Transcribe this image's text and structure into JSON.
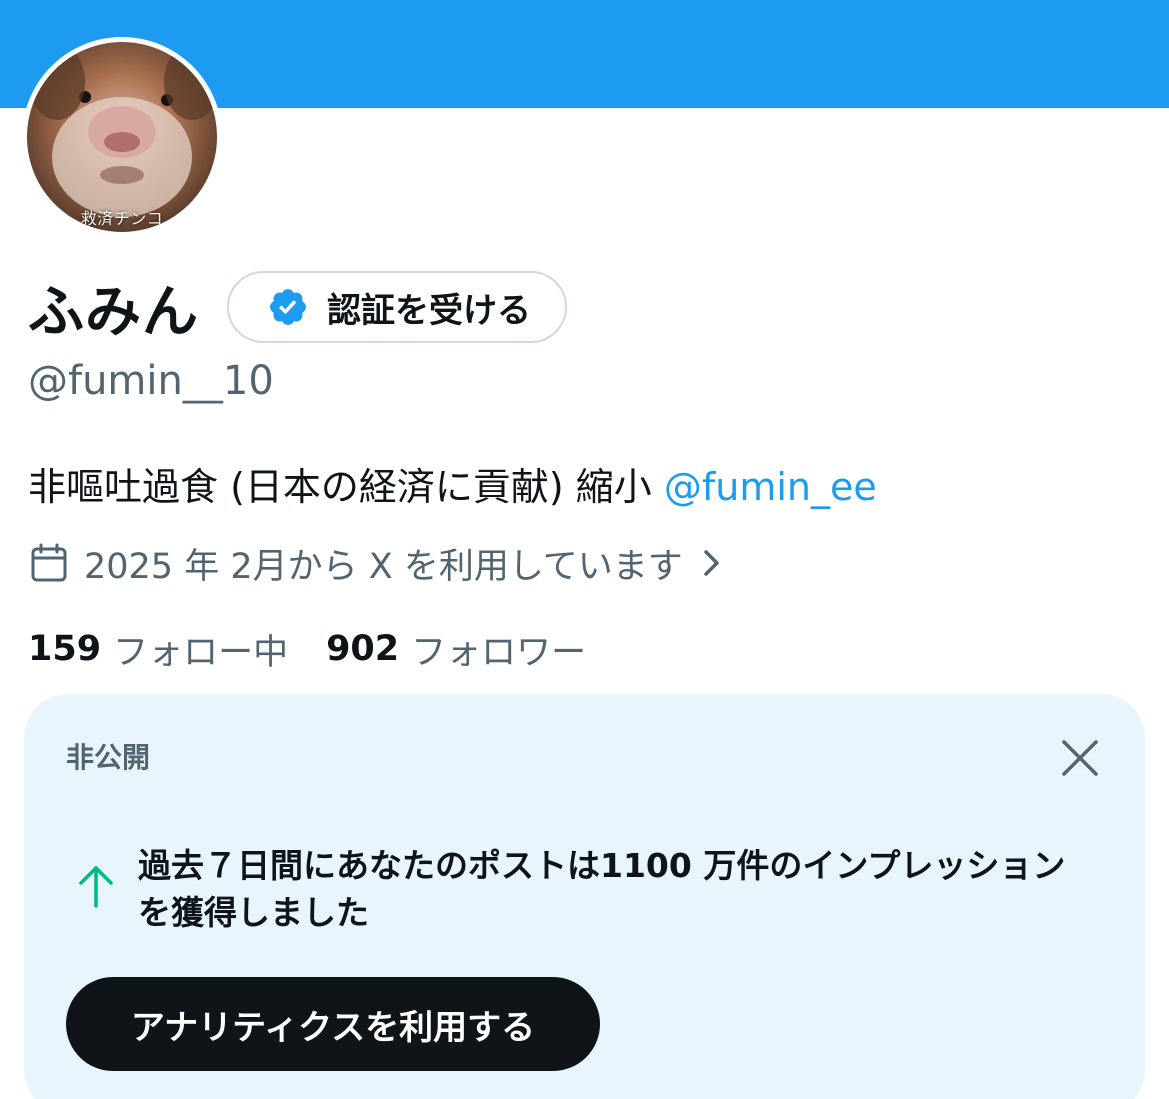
{
  "header": {
    "banner_color": "#1d9bf0"
  },
  "profile": {
    "avatar_caption": "救済チンコ",
    "display_name": "ふみん",
    "verify_label": "認証を受ける",
    "handle": "@fumin__10",
    "bio_text": "非嘔吐過食 (日本の経済に貢献) 縮小 ",
    "bio_mention": "@fumin_ee",
    "joined": "2025 年 2月から X を利用しています"
  },
  "stats": {
    "following_count": "159",
    "following_label": "フォロー中",
    "followers_count": "902",
    "followers_label": "フォロワー"
  },
  "insight_card": {
    "title": "非公開",
    "message": "過去７日間にあなたのポストは1100 万件のインプレッションを獲得しました",
    "cta_label": "アナリティクスを利用する"
  },
  "colors": {
    "accent": "#1d9bf0",
    "card_bg": "#e8f5fd",
    "secondary_text": "#536471",
    "positive": "#00ba7c"
  },
  "icons": {
    "verified": "verified-badge-icon",
    "calendar": "calendar-icon",
    "chevron": "chevron-right-icon",
    "close": "close-icon",
    "trend": "arrow-up-icon"
  }
}
